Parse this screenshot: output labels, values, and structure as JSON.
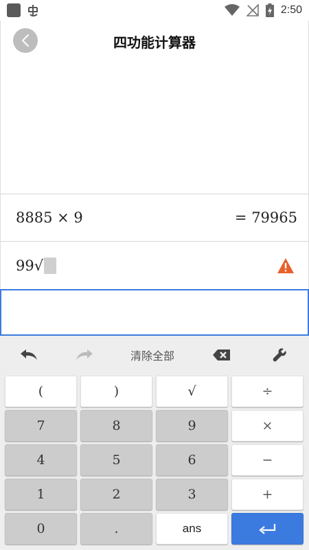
{
  "status_bar": {
    "time": "2:50"
  },
  "header": {
    "title": "四功能计算器"
  },
  "history": [
    {
      "expression": "8885 × 9",
      "result": "= 79965"
    }
  ],
  "current": {
    "expression": "99√"
  },
  "toolbar": {
    "clear_all_label": "清除全部"
  },
  "keypad": {
    "rows": [
      [
        "(",
        ")",
        "√",
        "÷"
      ],
      [
        "7",
        "8",
        "9",
        "×"
      ],
      [
        "4",
        "5",
        "6",
        "−"
      ],
      [
        "1",
        "2",
        "3",
        "+"
      ],
      [
        "0",
        ".",
        "ans",
        ""
      ]
    ]
  },
  "colors": {
    "accent": "#3b7be0",
    "warning": "#e8612c",
    "key_gray": "#cccccc",
    "key_light": "#ffffff"
  },
  "icons": {
    "back": "chevron-left-icon",
    "warning": "warning-icon",
    "undo": "undo-icon",
    "redo": "redo-icon",
    "backspace": "backspace-icon",
    "settings": "wrench-icon",
    "enter": "enter-icon"
  }
}
